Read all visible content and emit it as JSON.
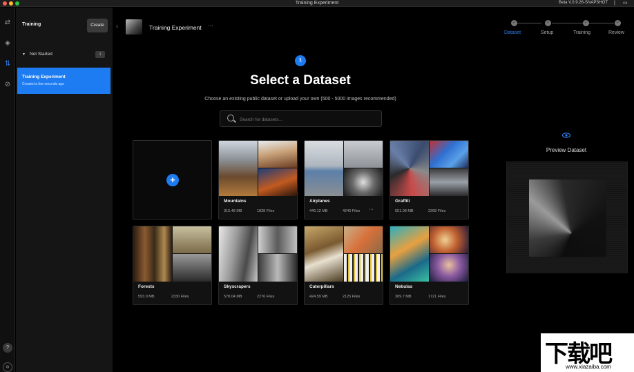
{
  "window": {
    "title": "Training Experiment",
    "version": "Beta V.0.9.26-SNAPSHOT"
  },
  "sidebar": {
    "title": "Training",
    "create_label": "Create",
    "group_label": "Not Started",
    "group_count": "1",
    "items": [
      {
        "title": "Training Experiment",
        "subtitle": "Created a few seconds ago"
      }
    ]
  },
  "header": {
    "experiment_title": "Training Experiment",
    "more": "···"
  },
  "stepper": {
    "steps": [
      "Dataset",
      "Setup",
      "Training",
      "Review"
    ],
    "active": "Dataset"
  },
  "main": {
    "step_number": "1",
    "title": "Select a Dataset",
    "subtitle": "Choose an existing public dataset or upload your own (500 - 5000 images recommended)",
    "search_placeholder": "Search for datasets..."
  },
  "datasets": [
    {
      "name": "Mountains",
      "size": "315.48 MB",
      "files": "1828 Files"
    },
    {
      "name": "Airplanes",
      "size": "446.12 MB",
      "files": "4240 Files"
    },
    {
      "name": "Graffiti",
      "size": "551.08 MB",
      "files": "2368 Files"
    },
    {
      "name": "Forests",
      "size": "593.9 MB",
      "files": "2330 Files"
    },
    {
      "name": "Skyscrapers",
      "size": "578.04 MB",
      "files": "2276 Files"
    },
    {
      "name": "Caterpillars",
      "size": "424.59 MB",
      "files": "2125 Files"
    },
    {
      "name": "Nebulas",
      "size": "309.7 MB",
      "files": "1721 Files"
    }
  ],
  "card_more": "···",
  "preview": {
    "title": "Preview Dataset"
  },
  "watermark": {
    "logo": "下载吧",
    "url": "www.xiazaiba.com"
  },
  "colors": {
    "accent": "#1e7cf2",
    "background": "#000000",
    "sidebar": "#151515"
  }
}
